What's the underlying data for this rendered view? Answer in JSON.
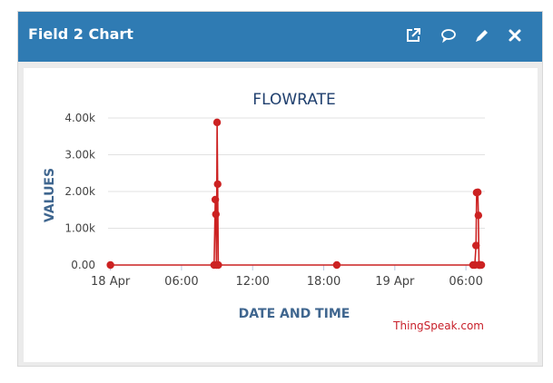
{
  "panel": {
    "title": "Field 2 Chart",
    "icons": [
      "open-external-icon",
      "comment-icon",
      "edit-pencil-icon",
      "close-icon"
    ],
    "header_color": "#2f7bb3"
  },
  "chart_data": {
    "type": "line",
    "title": "FLOWRATE",
    "xlabel": "DATE AND TIME",
    "ylabel": "VALUES",
    "credit": "ThingSpeak.com",
    "line_color": "#cc2222",
    "ylim": [
      0,
      4000
    ],
    "y_ticks": [
      {
        "value": 0,
        "label": "0.00"
      },
      {
        "value": 1000,
        "label": "1.00k"
      },
      {
        "value": 2000,
        "label": "2.00k"
      },
      {
        "value": 3000,
        "label": "3.00k"
      },
      {
        "value": 4000,
        "label": "4.00k"
      }
    ],
    "xlim_hours": [
      -0.2,
      31.6
    ],
    "x_ticks": [
      {
        "hour": 0,
        "label": "18 Apr"
      },
      {
        "hour": 6,
        "label": "06:00"
      },
      {
        "hour": 12,
        "label": "12:00"
      },
      {
        "hour": 18,
        "label": "18:00"
      },
      {
        "hour": 24,
        "label": "19 Apr"
      },
      {
        "hour": 30,
        "label": "06:00"
      }
    ],
    "grid": true,
    "legend": "none",
    "series": [
      {
        "x_hours": [
          0.0,
          8.75,
          8.85,
          8.9,
          8.95,
          9.0,
          9.05,
          9.1,
          19.1,
          30.6,
          30.75,
          30.85,
          30.9,
          31.0,
          31.05,
          31.1,
          31.15,
          31.2,
          31.3
        ],
        "y": [
          0,
          0,
          1780,
          1380,
          0,
          3880,
          2200,
          0,
          0,
          0,
          0,
          530,
          1970,
          1980,
          1350,
          0,
          0,
          0,
          0
        ]
      }
    ]
  }
}
